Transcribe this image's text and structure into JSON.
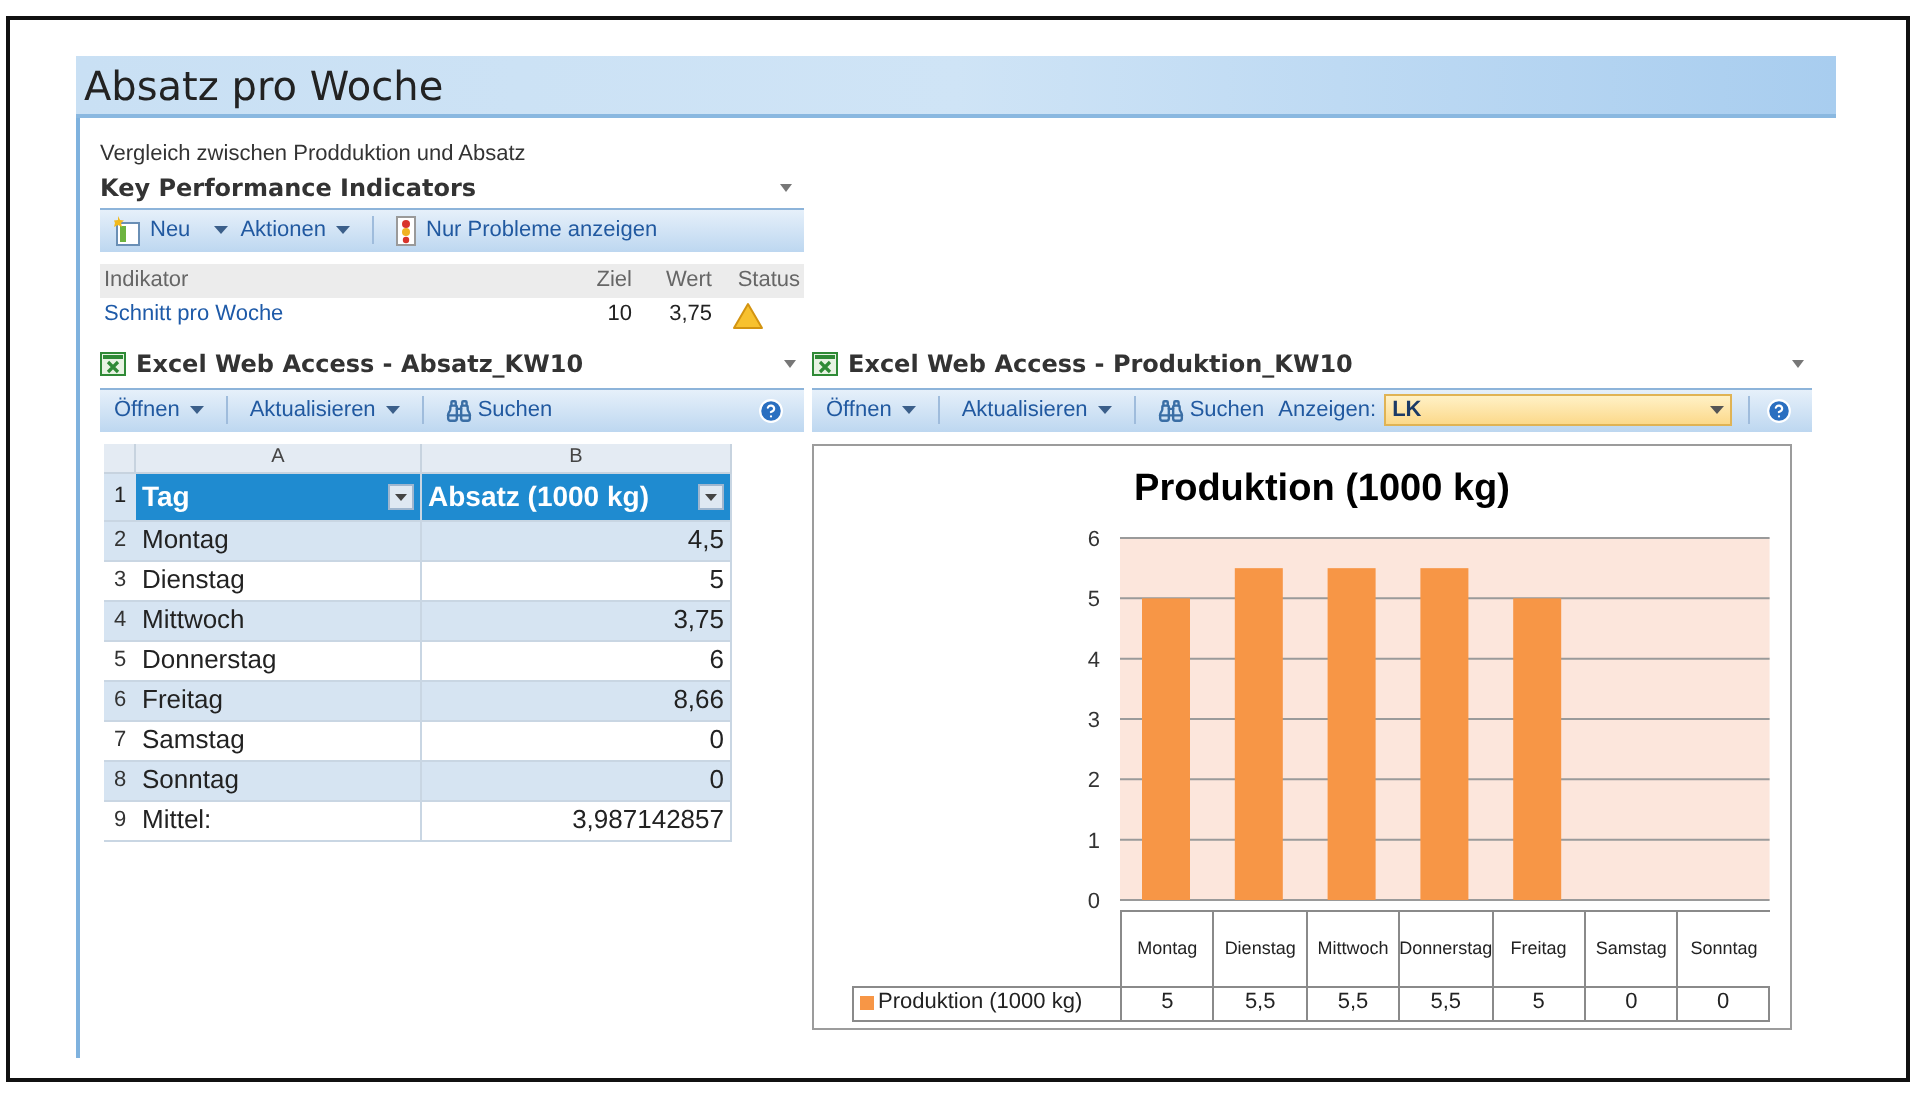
{
  "page_title": "Absatz pro Woche",
  "kpi": {
    "description": "Vergleich zwischen Prodduktion und Absatz",
    "title": "Key Performance Indicators",
    "toolbar": [
      {
        "label": "Neu",
        "kind": "new"
      },
      {
        "label": "Aktionen",
        "kind": "menu"
      },
      {
        "label": "Nur Probleme anzeigen",
        "kind": "filter"
      }
    ],
    "columns": [
      "Indikator",
      "Ziel",
      "Wert",
      "Status"
    ],
    "rows": [
      {
        "indicator": "Schnitt pro Woche",
        "goal": "10",
        "value": "3,75",
        "kind": "warning"
      }
    ]
  },
  "excel_parts": [
    {
      "title": "Excel Web Access - Absatz_KW10",
      "toolbar": [
        {
          "label": "Öffnen",
          "kind": "menu"
        },
        {
          "label": "Aktualisieren",
          "kind": "menu"
        },
        {
          "label": "Suchen",
          "kind": "search"
        }
      ],
      "grid": {
        "columns": [
          "A",
          "B"
        ],
        "rows": [
          {
            "number": "1",
            "kind": "header",
            "cells": [
              "Tag",
              "Absatz (1000 kg)"
            ]
          },
          {
            "number": "2",
            "kind": "data",
            "cells": [
              "Montag",
              "4,5"
            ]
          },
          {
            "number": "3",
            "kind": "data",
            "cells": [
              "Dienstag",
              "5"
            ]
          },
          {
            "number": "4",
            "kind": "data",
            "cells": [
              "Mittwoch",
              "3,75"
            ]
          },
          {
            "number": "5",
            "kind": "data",
            "cells": [
              "Donnerstag",
              "6"
            ]
          },
          {
            "number": "6",
            "kind": "data",
            "cells": [
              "Freitag",
              "8,66"
            ]
          },
          {
            "number": "7",
            "kind": "data",
            "cells": [
              "Samstag",
              "0"
            ]
          },
          {
            "number": "8",
            "kind": "data",
            "cells": [
              "Sonntag",
              "0"
            ]
          },
          {
            "number": "9",
            "kind": "data",
            "cells": [
              "Mittel:",
              "3,987142857"
            ]
          }
        ]
      }
    },
    {
      "title": "Excel Web Access - Produktion_KW10",
      "toolbar": [
        {
          "label": "Öffnen",
          "kind": "menu"
        },
        {
          "label": "Aktualisieren",
          "kind": "menu"
        },
        {
          "label": "Suchen",
          "kind": "search"
        },
        {
          "label": "Anzeigen:",
          "kind": "view-select",
          "value": "LK"
        }
      ],
      "chart": {
        "chart_data": {
          "type": "bar",
          "title": "Produktion (1000 kg)",
          "categories": [
            "Montag",
            "Dienstag",
            "Mittwoch",
            "Donnerstag",
            "Freitag",
            "Samstag",
            "Sonntag"
          ],
          "series": [
            {
              "name": "Produktion (1000 kg)",
              "color": "#f79646",
              "values": [
                5,
                5.5,
                5.5,
                5.5,
                5,
                0,
                0
              ]
            }
          ],
          "ylim": [
            0,
            6
          ],
          "grid": true,
          "yticks": [
            0,
            1,
            2,
            3,
            4,
            5,
            6
          ]
        },
        "data_table": [
          "5",
          "5,5",
          "5,5",
          "5,5",
          "5",
          "0",
          "0"
        ]
      }
    }
  ]
}
